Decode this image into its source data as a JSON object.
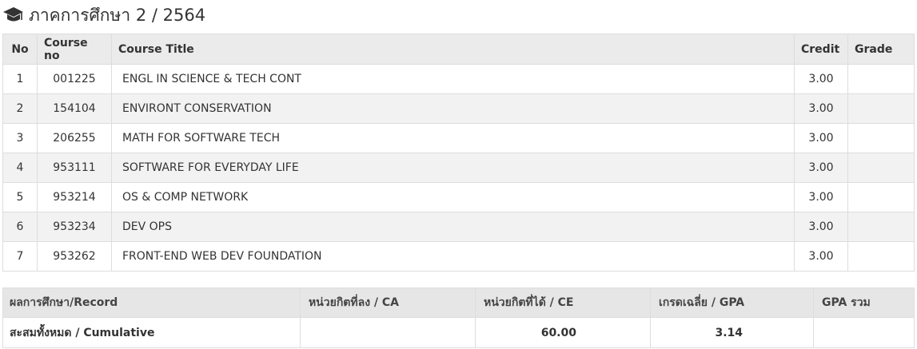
{
  "heading": {
    "icon": "graduation-cap-icon",
    "title": "ภาคการศึกษา 2 / 2564"
  },
  "courses": {
    "columns": {
      "no": "No",
      "code": "Course no",
      "title": "Course Title",
      "credit": "Credit",
      "grade": "Grade"
    },
    "rows": [
      {
        "no": "1",
        "code": "001225",
        "title": "ENGL IN SCIENCE & TECH CONT",
        "credit": "3.00",
        "grade": ""
      },
      {
        "no": "2",
        "code": "154104",
        "title": "ENVIRONT CONSERVATION",
        "credit": "3.00",
        "grade": ""
      },
      {
        "no": "3",
        "code": "206255",
        "title": "MATH FOR SOFTWARE TECH",
        "credit": "3.00",
        "grade": ""
      },
      {
        "no": "4",
        "code": "953111",
        "title": "SOFTWARE FOR EVERYDAY LIFE",
        "credit": "3.00",
        "grade": ""
      },
      {
        "no": "5",
        "code": "953214",
        "title": "OS & COMP NETWORK",
        "credit": "3.00",
        "grade": ""
      },
      {
        "no": "6",
        "code": "953234",
        "title": "DEV OPS",
        "credit": "3.00",
        "grade": ""
      },
      {
        "no": "7",
        "code": "953262",
        "title": "FRONT-END WEB DEV FOUNDATION",
        "credit": "3.00",
        "grade": ""
      }
    ]
  },
  "summary": {
    "headers": {
      "record": "ผลการศึกษา/Record",
      "ca": "หน่วยกิตที่ลง / CA",
      "ce": "หน่วยกิตที่ได้ / CE",
      "gpa": "เกรดเฉลี่ย / GPA",
      "gpa_total": "GPA รวม"
    },
    "row": {
      "label": "สะสมทั้งหมด / Cumulative",
      "ca": "",
      "ce": "60.00",
      "gpa": "3.14",
      "gpa_total": ""
    }
  }
}
